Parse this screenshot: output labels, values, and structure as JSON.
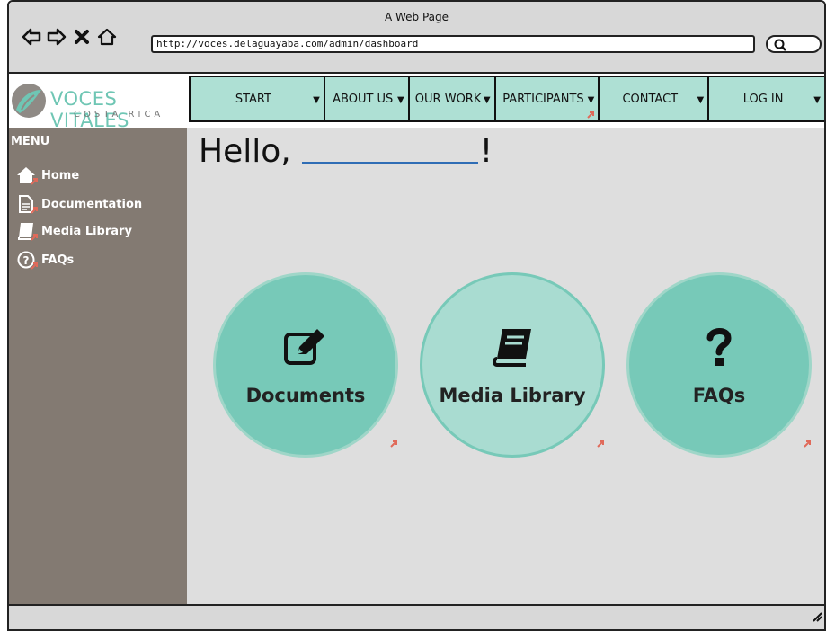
{
  "browser": {
    "title": "A Web Page",
    "url": "http://voces.delaguayaba.com/admin/dashboard",
    "icons": [
      "back-arrow-icon",
      "forward-arrow-icon",
      "close-icon",
      "home-icon",
      "search-icon"
    ]
  },
  "logo": {
    "name": "VOCES VITALES",
    "sub": "COSTA RICA"
  },
  "nav": [
    {
      "label": "START"
    },
    {
      "label": "ABOUT US"
    },
    {
      "label": "OUR WORK"
    },
    {
      "label": "PARTICIPANTS"
    },
    {
      "label": "CONTACT"
    },
    {
      "label": "LOG IN"
    }
  ],
  "sidebar": {
    "title": "MENU",
    "items": [
      {
        "label": "Home",
        "icon": "home-icon"
      },
      {
        "label": "Documentation",
        "icon": "document-icon"
      },
      {
        "label": "Media Library",
        "icon": "book-icon"
      },
      {
        "label": "FAQs",
        "icon": "question-circle-icon"
      }
    ]
  },
  "main": {
    "greeting": "Hello,",
    "exclaim": "!",
    "cards": [
      {
        "label": "Documents",
        "icon": "edit-icon"
      },
      {
        "label": "Media Library",
        "icon": "book-icon"
      },
      {
        "label": "FAQs",
        "icon": "question-icon"
      }
    ]
  },
  "colors": {
    "accent": "#77c9b8",
    "accent_light": "#a9dcd1",
    "nav_bg": "#aee0d4",
    "sidebar_bg": "#837a72",
    "link_mark": "#e06a5a"
  }
}
